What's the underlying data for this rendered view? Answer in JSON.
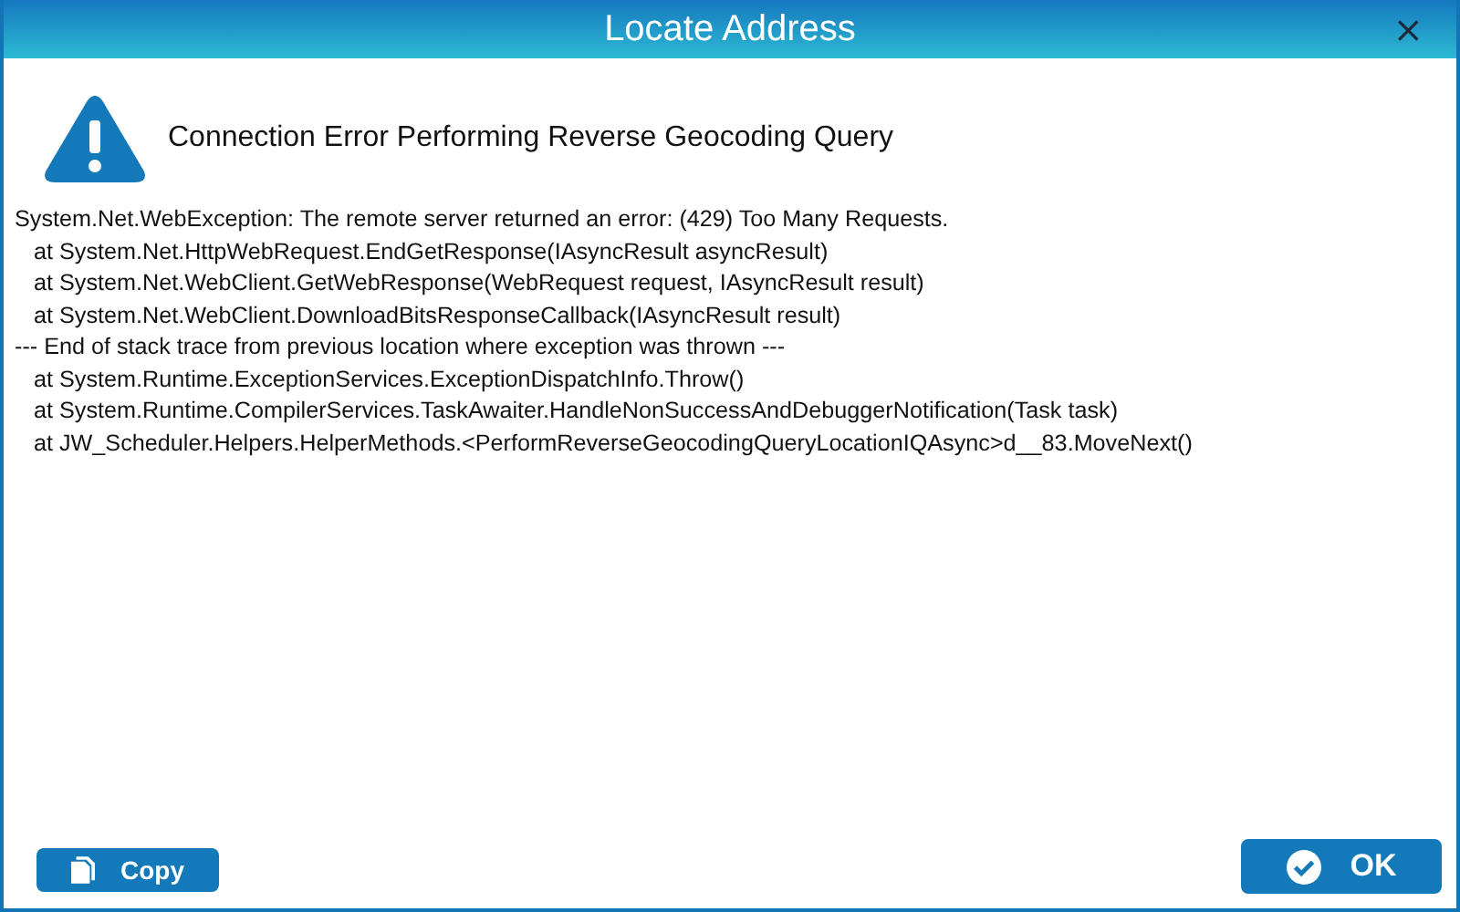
{
  "window": {
    "title": "Locate Address",
    "close": "×"
  },
  "heading": "Connection Error Performing Reverse Geocoding Query",
  "details": [
    "System.Net.WebException: The remote server returned an error: (429) Too Many Requests.",
    "   at System.Net.HttpWebRequest.EndGetResponse(IAsyncResult asyncResult)",
    "   at System.Net.WebClient.GetWebResponse(WebRequest request, IAsyncResult result)",
    "   at System.Net.WebClient.DownloadBitsResponseCallback(IAsyncResult result)",
    "--- End of stack trace from previous location where exception was thrown ---",
    "   at System.Runtime.ExceptionServices.ExceptionDispatchInfo.Throw()",
    "   at System.Runtime.CompilerServices.TaskAwaiter.HandleNonSuccessAndDebuggerNotification(Task task)",
    "   at JW_Scheduler.Helpers.HelperMethods.<PerformReverseGeocodingQueryLocationIQAsync>d__83.MoveNext()"
  ],
  "buttons": [
    {
      "kind": "copy",
      "label": "Copy"
    },
    {
      "kind": "ok",
      "label": "OK"
    }
  ]
}
